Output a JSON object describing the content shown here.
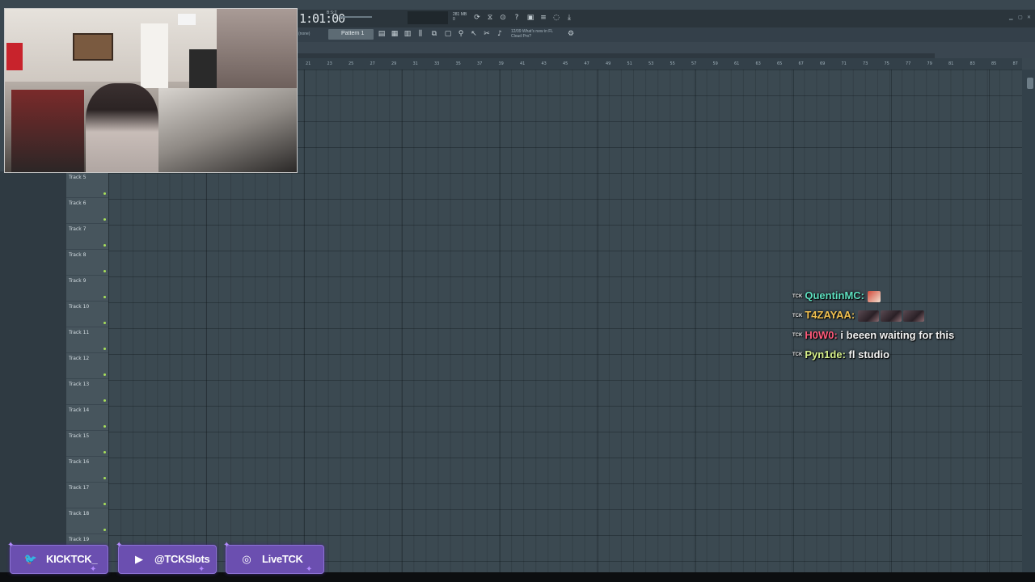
{
  "toolbar": {
    "time": "1:01:00",
    "time_sub": "B:S:T",
    "memory_value": "281 MB",
    "memory_sub": "0",
    "mode_label": "(none)",
    "pattern": "Pattern 1",
    "news_line1": "12/09 What's new in FL",
    "news_line2": "Cloud Pro?"
  },
  "ruler": [
    "21",
    "23",
    "25",
    "27",
    "29",
    "31",
    "33",
    "35",
    "37",
    "39",
    "41",
    "43",
    "45",
    "47",
    "49",
    "51",
    "53",
    "55",
    "57",
    "59",
    "61",
    "63",
    "65",
    "67",
    "69",
    "71",
    "73",
    "75",
    "77",
    "79",
    "81",
    "83",
    "85",
    "87"
  ],
  "tracks": [
    "Track 5",
    "Track 6",
    "Track 7",
    "Track 8",
    "Track 9",
    "Track 10",
    "Track 11",
    "Track 12",
    "Track 13",
    "Track 14",
    "Track 15",
    "Track 16",
    "Track 17",
    "Track 18",
    "Track 19"
  ],
  "chat": [
    {
      "user": "QuentinMC",
      "user_color": "#5ee0c0",
      "badge": "TCK",
      "message": "",
      "emotes": 1
    },
    {
      "user": "T4ZAYAA",
      "user_color": "#f0c050",
      "badge": "TCK",
      "message": "",
      "emotes": 3
    },
    {
      "user": "H0W0",
      "user_color": "#ff5a7a",
      "badge": "TCK",
      "message": "i beeen waiting for this",
      "emotes": 0
    },
    {
      "user": "Pyn1de",
      "user_color": "#d6f08a",
      "badge": "TCK",
      "message": "fl studio",
      "emotes": 0
    }
  ],
  "socials": [
    {
      "icon": "twitter-icon",
      "glyph": "🐦",
      "text": "KICKTCK_"
    },
    {
      "icon": "youtube-icon",
      "glyph": "▶",
      "text": "@TCKSlots"
    },
    {
      "icon": "instagram-icon",
      "glyph": "◎",
      "text": "LiveTCK"
    }
  ],
  "colors": {
    "accent": "#6b4fb0",
    "grid": "#3b4951",
    "track_led": "#a8e05a"
  }
}
